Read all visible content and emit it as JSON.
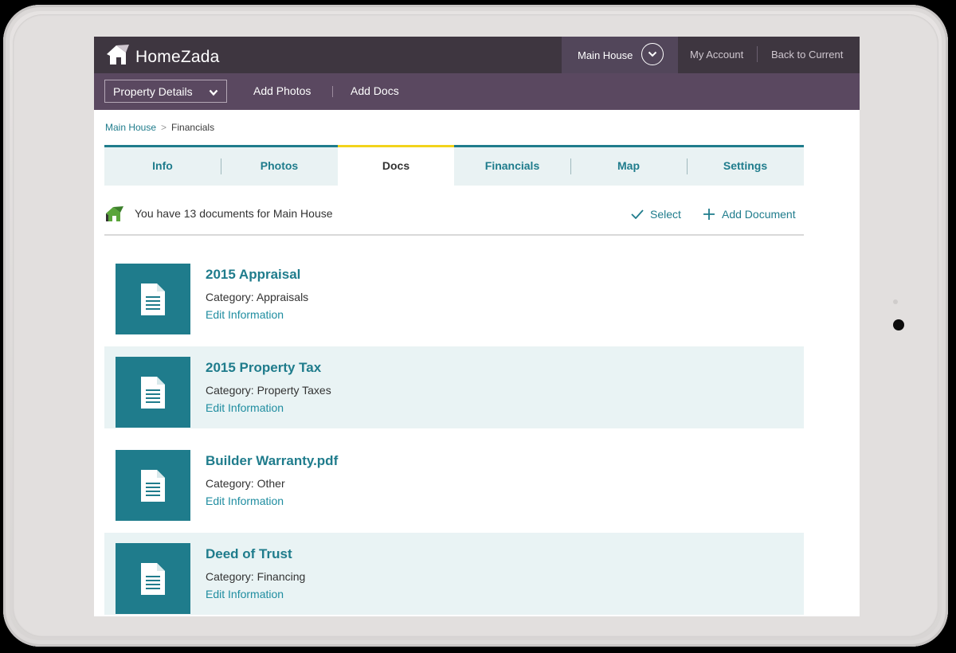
{
  "app": {
    "name": "HomeZada"
  },
  "topbar": {
    "property_selector": "Main House",
    "links": [
      "My Account",
      "Back to Current"
    ]
  },
  "subbar": {
    "dropdown_label": "Property Details",
    "links": [
      "Add Photos",
      "Add Docs"
    ]
  },
  "breadcrumb": [
    "Main House",
    "Financials"
  ],
  "tabs": [
    {
      "label": "Info",
      "active": false
    },
    {
      "label": "Photos",
      "active": false
    },
    {
      "label": "Docs",
      "active": true
    },
    {
      "label": "Financials",
      "active": false
    },
    {
      "label": "Map",
      "active": false
    },
    {
      "label": "Settings",
      "active": false
    }
  ],
  "summary": {
    "text": "You have 13 documents for Main House",
    "select_label": "Select",
    "add_label": "Add Document"
  },
  "documents": [
    {
      "title": "2015 Appraisal",
      "category": "Category: Appraisals",
      "edit": "Edit Information"
    },
    {
      "title": "2015 Property Tax",
      "category": "Category: Property Taxes",
      "edit": "Edit Information"
    },
    {
      "title": "Builder Warranty.pdf",
      "category": "Category: Other",
      "edit": "Edit Information"
    },
    {
      "title": "Deed of Trust",
      "category": "Category: Financing",
      "edit": "Edit Information"
    }
  ],
  "colors": {
    "topbar": "#3e3640",
    "subbar": "#5a4860",
    "accent": "#1f7c8c",
    "active_tab": "#f2d31b",
    "row_alt": "#e9f3f4"
  },
  "icons": [
    "house-logo-icon",
    "chevron-down-icon",
    "check-icon",
    "plus-icon",
    "document-icon"
  ]
}
